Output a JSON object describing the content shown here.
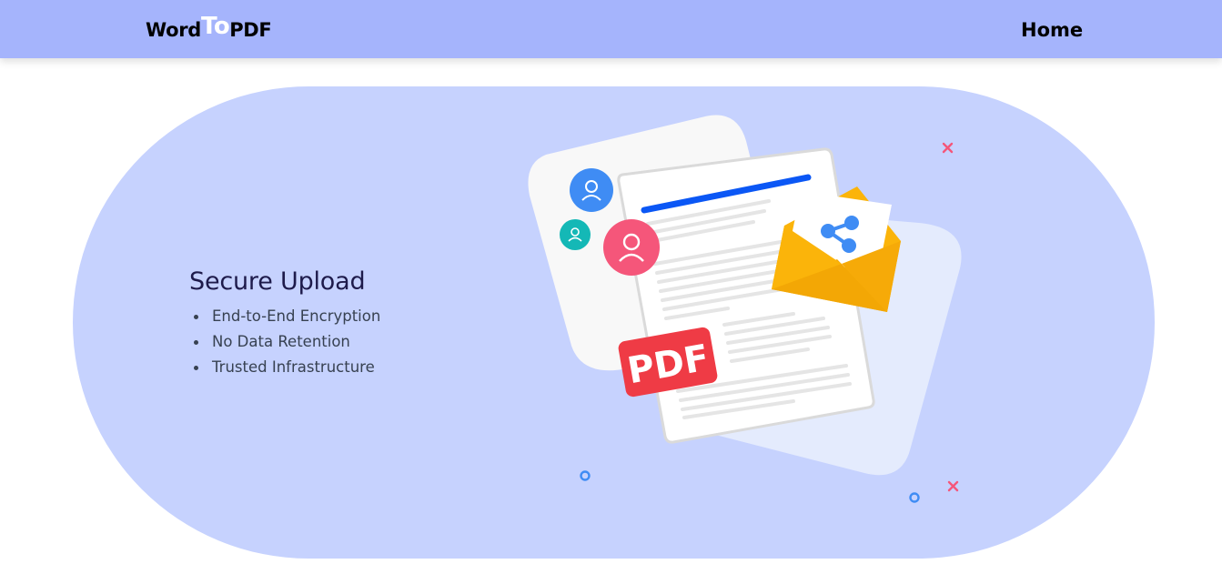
{
  "header": {
    "logo": {
      "part1": "Word",
      "part2": "To",
      "part3": "PDF"
    },
    "nav": {
      "home_label": "Home"
    }
  },
  "hero": {
    "title": "Secure Upload",
    "features": [
      "End-to-End Encryption",
      "No Data Retention",
      "Trusted Infrastructure"
    ],
    "illustration": {
      "badge_text": "PDF",
      "icons": [
        "user-icon",
        "user-icon",
        "user-icon",
        "share-icon",
        "envelope-icon",
        "document-icon"
      ]
    }
  },
  "colors": {
    "navbar_bg": "#a5b4fc",
    "hero_bg": "#c6d2fe",
    "title": "#1e1b4b",
    "pdf_badge": "#ef3b45",
    "envelope": "#fbb40a",
    "accent_blue": "#0b57f5"
  }
}
